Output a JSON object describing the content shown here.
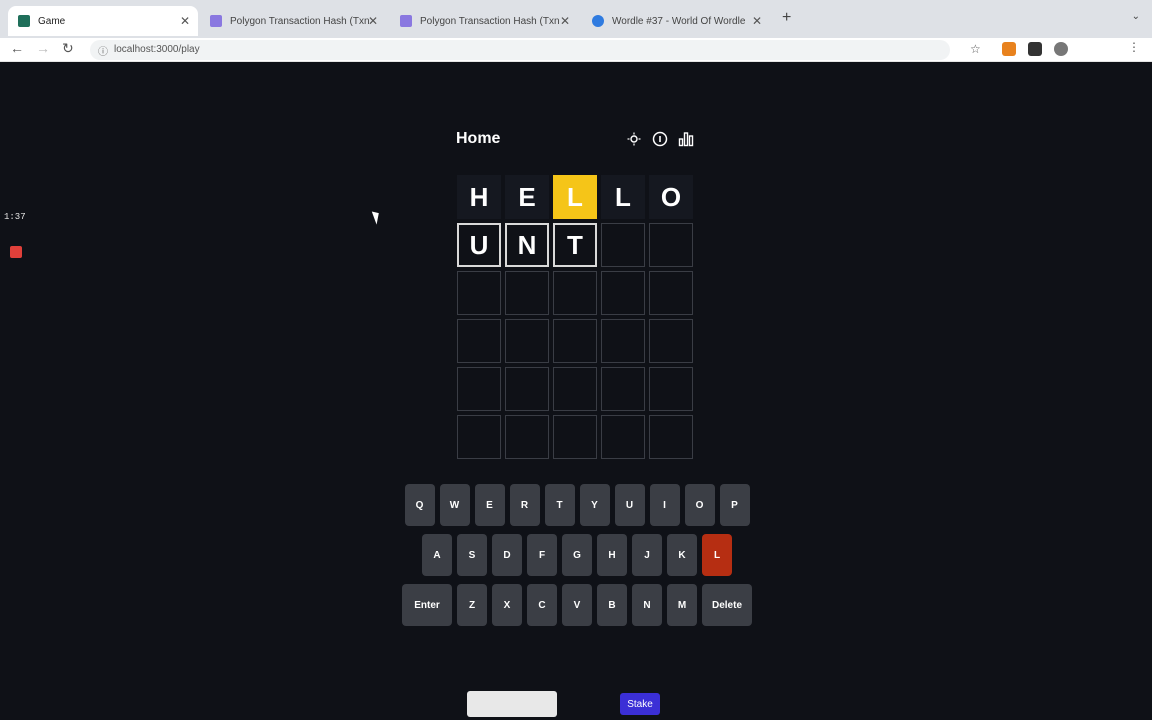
{
  "browser": {
    "tabs": [
      {
        "title": "Game",
        "active": true
      },
      {
        "title": "Polygon Transaction Hash (Txn",
        "active": false
      },
      {
        "title": "Polygon Transaction Hash (Txn",
        "active": false
      },
      {
        "title": "Wordle #37 - World Of Wordle",
        "active": false
      }
    ],
    "url": "localhost:3000/play"
  },
  "recorder": {
    "time": "1:37"
  },
  "header": {
    "title": "Home",
    "icons": [
      "sun-icon",
      "info-icon",
      "chart-icon"
    ]
  },
  "board": {
    "rows": [
      [
        "H",
        "E",
        "L",
        "L",
        "O"
      ],
      [
        "U",
        "N",
        "T",
        "",
        ""
      ],
      [
        "",
        "",
        "",
        "",
        ""
      ],
      [
        "",
        "",
        "",
        "",
        ""
      ],
      [
        "",
        "",
        "",
        "",
        ""
      ],
      [
        "",
        "",
        "",
        "",
        ""
      ]
    ],
    "states": [
      [
        "absent",
        "absent",
        "present",
        "absent",
        "absent"
      ],
      [
        "filled",
        "filled",
        "filled",
        "empty",
        "empty"
      ],
      [
        "empty",
        "empty",
        "empty",
        "empty",
        "empty"
      ],
      [
        "empty",
        "empty",
        "empty",
        "empty",
        "empty"
      ],
      [
        "empty",
        "empty",
        "empty",
        "empty",
        "empty"
      ],
      [
        "empty",
        "empty",
        "empty",
        "empty",
        "empty"
      ]
    ]
  },
  "keyboard": {
    "rows": [
      [
        "Q",
        "W",
        "E",
        "R",
        "T",
        "Y",
        "U",
        "I",
        "O",
        "P"
      ],
      [
        "A",
        "S",
        "D",
        "F",
        "G",
        "H",
        "J",
        "K",
        "L"
      ],
      [
        "Enter",
        "Z",
        "X",
        "C",
        "V",
        "B",
        "N",
        "M",
        "Delete"
      ]
    ],
    "used": [
      "L"
    ]
  },
  "footer": {
    "left_label": "",
    "stake_label": "Stake"
  },
  "colors": {
    "present": "#f5c518",
    "used_key": "#b62e12",
    "stake": "#3b2fd6"
  }
}
